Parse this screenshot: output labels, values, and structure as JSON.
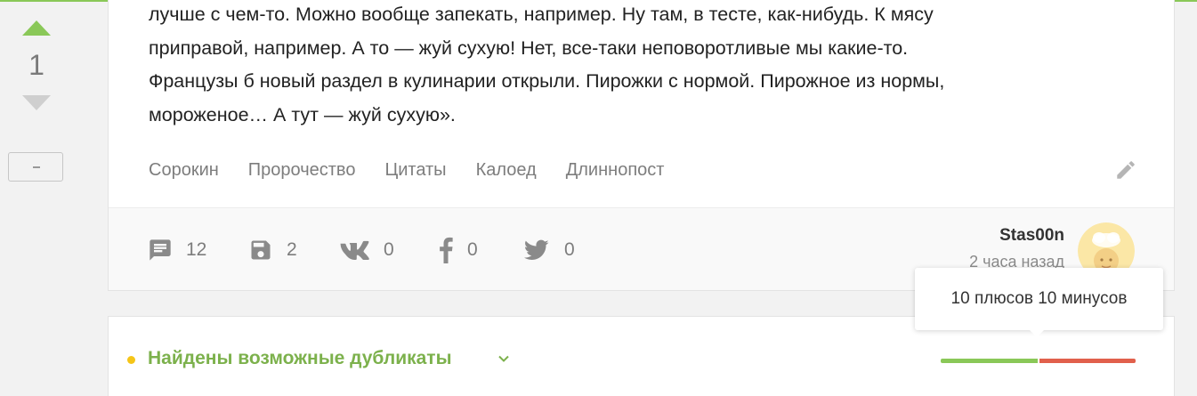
{
  "rating": {
    "value": "1"
  },
  "story": {
    "text_lines": [
      "лучше с чем-то. Можно вообще запекать, например. Ну там, в тесте, как-нибудь. К мясу",
      "приправой, например. А то — жуй сухую! Нет, все-таки неповоротливые мы какие-то.",
      "Французы б новый раздел в кулинарии открыли. Пирожки с нормой. Пирожное из нормы,",
      "мороженое… А тут — жуй сухую»."
    ],
    "tags": [
      "Сорокин",
      "Пророчество",
      "Цитаты",
      "Калоед",
      "Длиннопост"
    ]
  },
  "footer": {
    "comments": "12",
    "saves": "2",
    "vk": "0",
    "facebook": "0",
    "twitter": "0",
    "author": "Stas00n",
    "time": "2 часа назад"
  },
  "tooltip": {
    "text": "10 плюсов 10 минусов"
  },
  "duplicates": {
    "title": "Найдены возможные дубликаты",
    "plus_fraction": 0.5,
    "minus_fraction": 0.5
  },
  "colors": {
    "accent_green": "#8ac858",
    "title_green": "#7cb14c",
    "minus_red": "#e1604c",
    "dot_yellow": "#f5c518"
  }
}
